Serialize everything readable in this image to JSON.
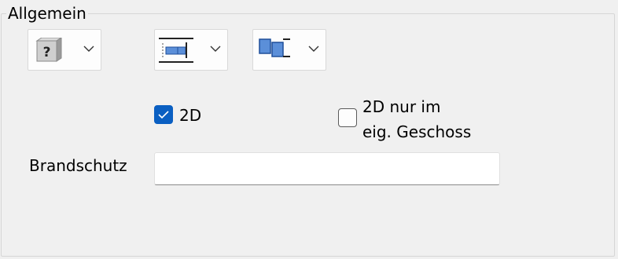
{
  "group": {
    "title": "Allgemein"
  },
  "checkboxes": [
    {
      "label": "2D",
      "checked": true
    },
    {
      "label_line1": "2D nur im",
      "label_line2": "eig. Geschoss",
      "checked": false
    }
  ],
  "fire_protection": {
    "label": "Brandschutz",
    "value": ""
  },
  "dropdowns": [
    {
      "icon": "unknown-material-icon"
    },
    {
      "icon": "layer-alignment-icon"
    },
    {
      "icon": "element-connection-icon"
    }
  ],
  "colors": {
    "accent": "#0a5fc2",
    "icon_blue": "#5b8fd9"
  }
}
